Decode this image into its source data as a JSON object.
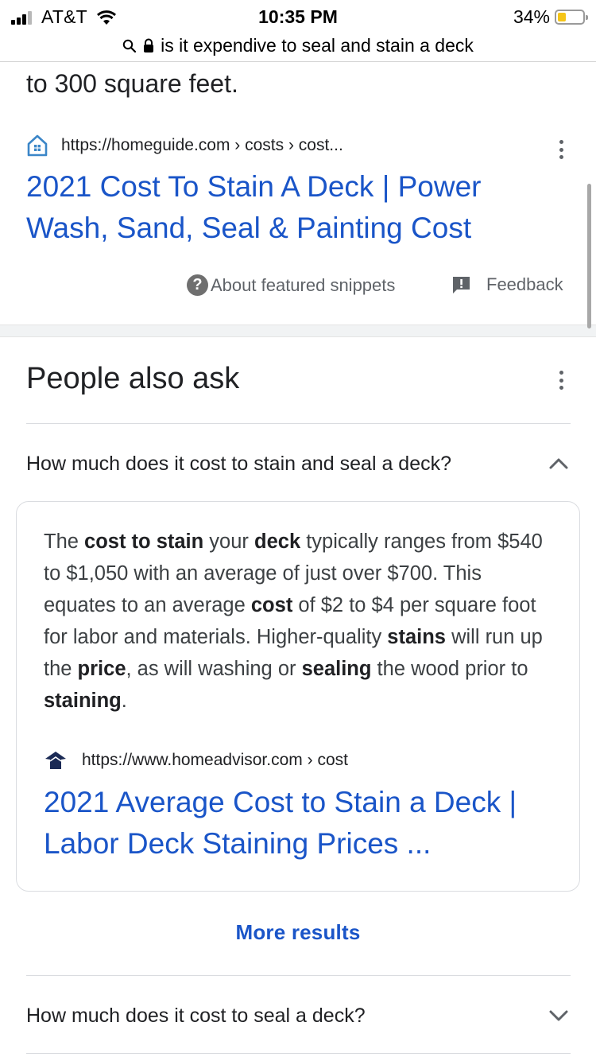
{
  "status_bar": {
    "carrier": "AT&T",
    "time": "10:35 PM",
    "battery_pct": "34%",
    "battery_level": 0.34,
    "battery_color": "#f5c518"
  },
  "url_bar": {
    "text": "is it expendive to seal and stain a deck",
    "icons": [
      "search-icon",
      "lock-icon"
    ]
  },
  "content": {
    "cut_text": "to 300 square feet.",
    "featured_result": {
      "source_url": "https://homeguide.com › costs › cost...",
      "title_line1": "2021 Cost To Stain A Deck | Power",
      "title_line2": "Wash, Sand, Seal & Painting Cost"
    },
    "about_snippets": "About featured snippets",
    "feedback": "Feedback"
  },
  "paa": {
    "title": "People also ask",
    "questions": [
      {
        "text": "How much does it cost to stain and seal a deck?",
        "expanded": true
      },
      {
        "text": "How much does it cost to seal a deck?",
        "expanded": false
      }
    ],
    "answer": {
      "segments": [
        {
          "t": "The ",
          "b": false
        },
        {
          "t": "cost to stain",
          "b": true
        },
        {
          "t": " your ",
          "b": false
        },
        {
          "t": "deck",
          "b": true
        },
        {
          "t": " typically ranges from $540 to $1,050 with an average of just over $700. This equates to an average ",
          "b": false
        },
        {
          "t": "cost",
          "b": true
        },
        {
          "t": " of $2 to $4 per square foot for labor and materials. Higher-quality ",
          "b": false
        },
        {
          "t": "stains",
          "b": true
        },
        {
          "t": " will run up the ",
          "b": false
        },
        {
          "t": "price",
          "b": true
        },
        {
          "t": ", as will washing or ",
          "b": false
        },
        {
          "t": "sealing",
          "b": true
        },
        {
          "t": " the wood prior to ",
          "b": false
        },
        {
          "t": "staining",
          "b": true
        },
        {
          "t": ".",
          "b": false
        }
      ],
      "source_url": "https://www.homeadvisor.com › cost",
      "title_line1": "2021 Average Cost to Stain a Deck |",
      "title_line2": "Labor Deck Staining Prices ..."
    },
    "more_results": "More results"
  },
  "colors": {
    "link": "#1a55c8",
    "text": "#202124",
    "muted": "#5f6368"
  }
}
